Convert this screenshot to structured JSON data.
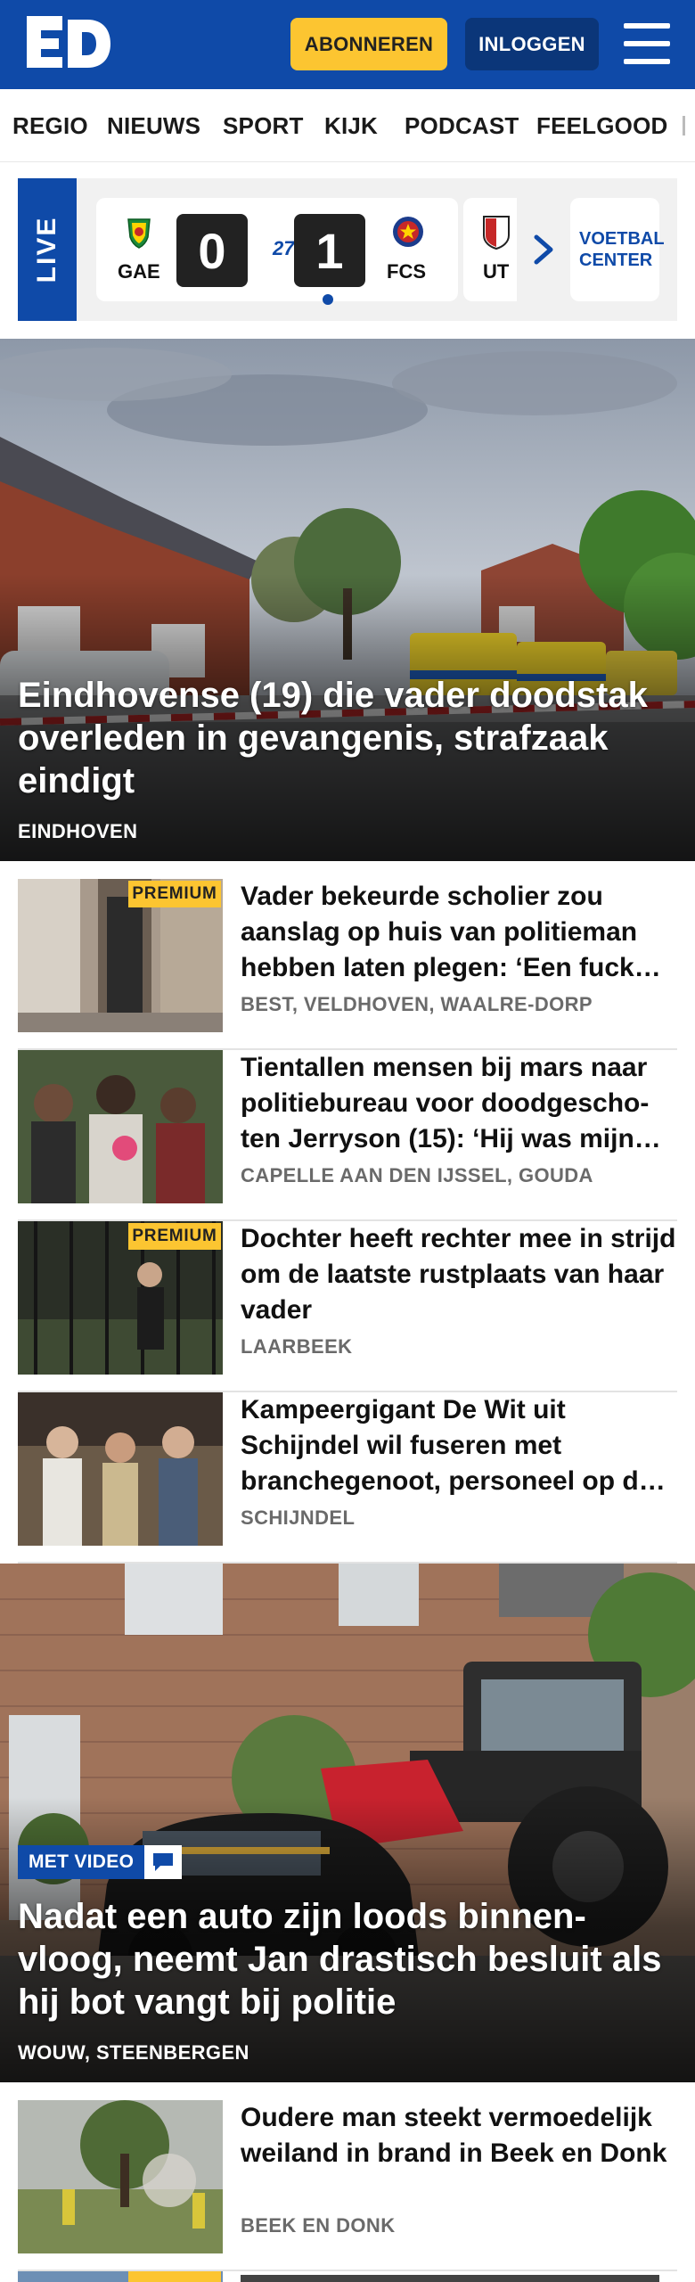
{
  "header": {
    "logo_text": "ED",
    "subscribe_label": "ABONNEREN",
    "login_label": "INLOGGEN",
    "menu_icon": "hamburger-menu-icon",
    "brand_color": "#0f4aa8",
    "accent_color": "#fcc531"
  },
  "nav": {
    "items": [
      "REGIO",
      "NIEUWS",
      "SPORT",
      "KIJK",
      "PODCAST",
      "FEELGOOD"
    ]
  },
  "scores": {
    "live_label": "LIVE",
    "match": {
      "home_code": "GAE",
      "away_code": "FCS",
      "home_score": "0",
      "away_score": "1",
      "minute": "27'"
    },
    "next_match_code": "UT",
    "voetbal_center_label": "VOETBAL CENTER"
  },
  "hero1": {
    "title": "Eindhovense (19) die vader doodstak overleden in gevangenis, strafzaak eindigt",
    "location": "EINDHOVEN"
  },
  "articles1": [
    {
      "title": "Vader bekeurde scholier zou aanslag op huis van politieman hebben laten plegen: ‘Een fuck you naar de politie’",
      "location": "BEST, VELDHOVEN, WAALRE-DORP",
      "premium": "PREMIUM"
    },
    {
      "title": "Tientallen mensen bij mars naar politiebureau voor doodgescho­ten Jerryson (15): ‘Hij was mijn alles’",
      "location": "CAPELLE AAN DEN IJSSEL, GOUDA",
      "premium": ""
    },
    {
      "title": "Dochter heeft rechter mee in strijd om de laatste rustplaats van haar vader",
      "location": "LAARBEEK",
      "premium": "PREMIUM"
    },
    {
      "title": "Kampeergigant De Wit uit Schijndel wil fuseren met branchegenoot, personeel op de hoogte gebracht",
      "location": "SCHIJNDEL",
      "premium": ""
    }
  ],
  "hero2": {
    "badge_label": "MET VIDEO",
    "badge_icon": "chat-bubble-icon",
    "title": "Nadat een auto zijn loods binnen­vloog, neemt Jan drastisch besluit als hij bot vangt bij politie",
    "location": "WOUW, STEENBERGEN"
  },
  "articles2": [
    {
      "title": "Oudere man steekt vermoedelijk weiland in brand in Beek en Donk",
      "location": "BEEK EN DONK",
      "premium": ""
    }
  ],
  "next_partial": {
    "premium": "PREMIUM"
  }
}
